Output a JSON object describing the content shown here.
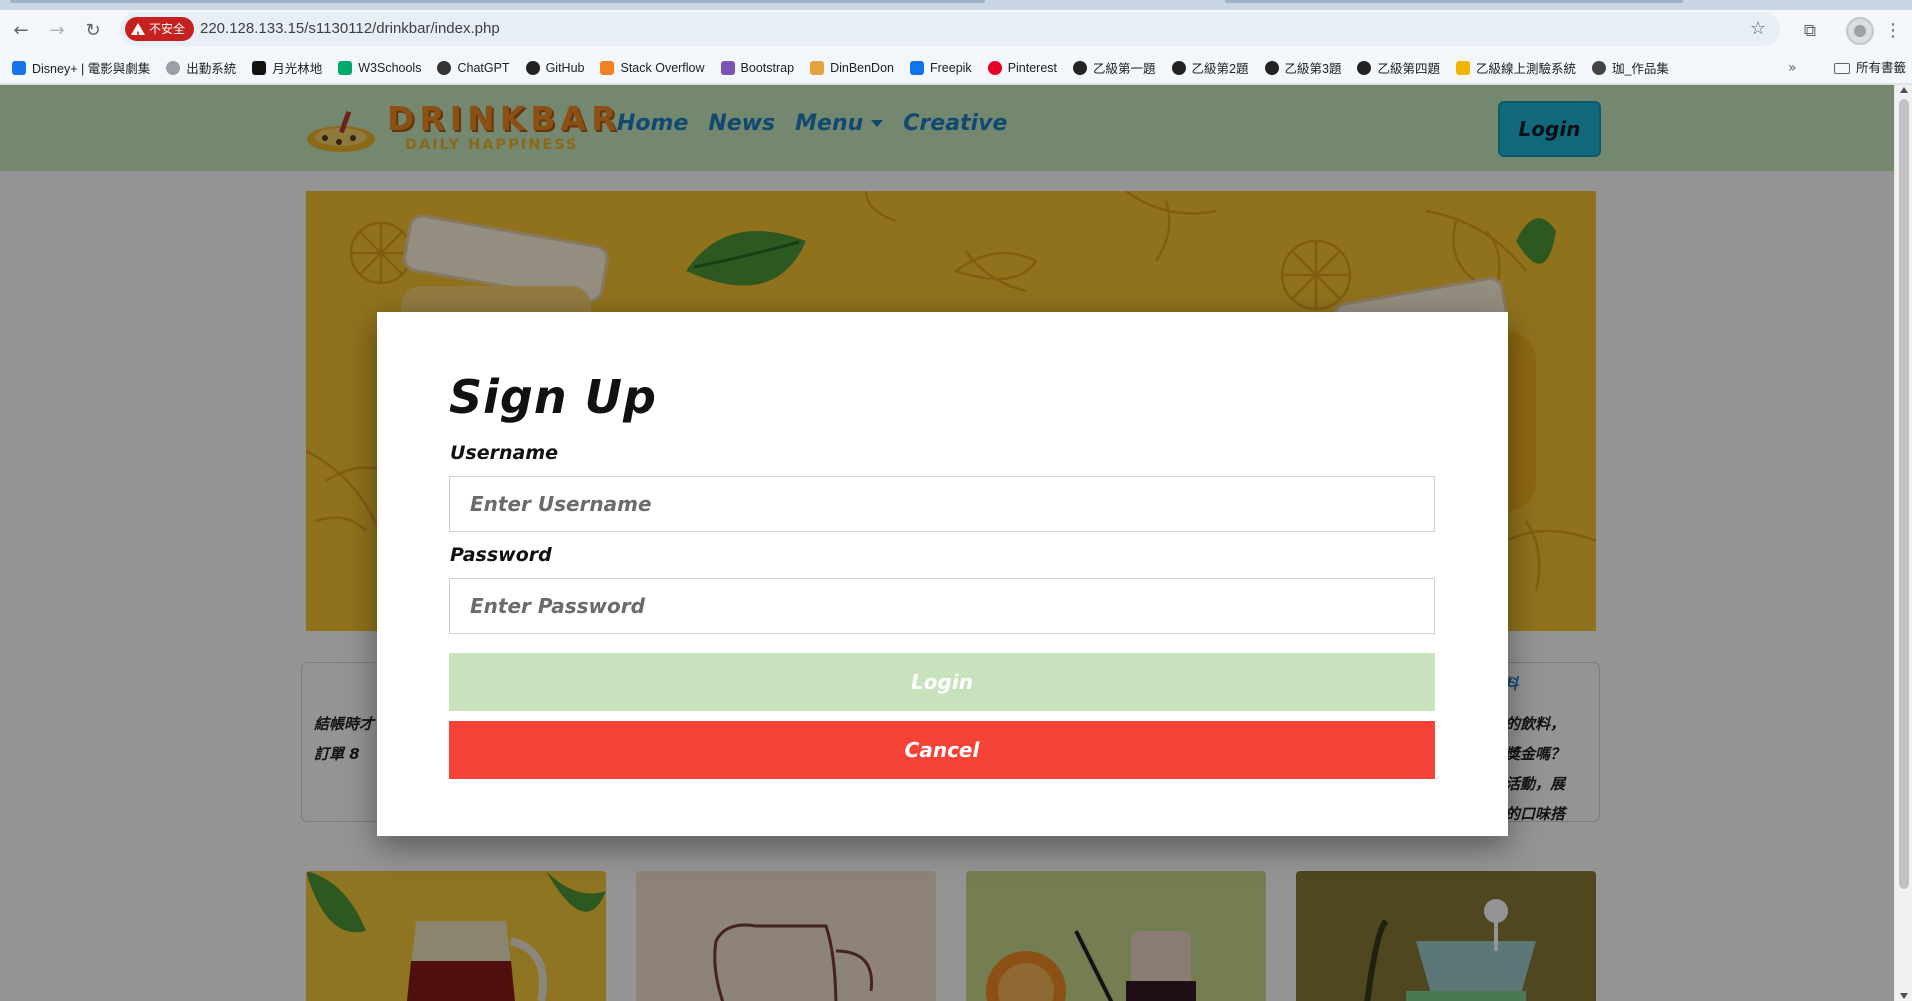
{
  "browser": {
    "security_label": "不安全",
    "url": "220.128.133.15/s1130112/drinkbar/index.php",
    "bookmarks": [
      {
        "label": "Disney+ | 電影與劇集",
        "icon": "disney-icon",
        "color": "#1a73e8"
      },
      {
        "label": "出勤系統",
        "icon": "globe-icon",
        "color": "#9aa0a6"
      },
      {
        "label": "月光林地",
        "icon": "notion-icon",
        "color": "#111111"
      },
      {
        "label": "W3Schools",
        "icon": "w3schools-icon",
        "color": "#04aa6d"
      },
      {
        "label": "ChatGPT",
        "icon": "chatgpt-icon",
        "color": "#333333"
      },
      {
        "label": "GitHub",
        "icon": "github-icon",
        "color": "#222222"
      },
      {
        "label": "Stack Overflow",
        "icon": "stackoverflow-icon",
        "color": "#f48024"
      },
      {
        "label": "Bootstrap",
        "icon": "bootstrap-icon",
        "color": "#7952b3"
      },
      {
        "label": "DinBenDon",
        "icon": "dinbendon-icon",
        "color": "#e6a23c"
      },
      {
        "label": "Freepik",
        "icon": "freepik-icon",
        "color": "#1273eb"
      },
      {
        "label": "Pinterest",
        "icon": "pinterest-icon",
        "color": "#e60023"
      },
      {
        "label": "乙級第一題",
        "icon": "github-icon",
        "color": "#222222"
      },
      {
        "label": "乙級第2題",
        "icon": "github-icon",
        "color": "#222222"
      },
      {
        "label": "乙級第3題",
        "icon": "github-icon",
        "color": "#222222"
      },
      {
        "label": "乙級第四題",
        "icon": "github-icon",
        "color": "#222222"
      },
      {
        "label": "乙級線上測驗系統",
        "icon": "exam-icon",
        "color": "#f2b400"
      },
      {
        "label": "珈_作品集",
        "icon": "globe-icon",
        "color": "#444444"
      }
    ],
    "all_bookmarks_label": "所有書籤"
  },
  "site": {
    "logo_word": "DRINKBAR",
    "logo_tagline": "DAILY HAPPINESS",
    "nav": [
      "Home",
      "News",
      "Menu",
      "Creative"
    ],
    "login_label": "Login",
    "card_left_lines": [
      "結帳時才",
      "訂單 8"
    ],
    "card_right_heading": "料",
    "card_right_lines": [
      "的飲料，",
      "獎金嗎？",
      "活動，展",
      "的口味搭"
    ]
  },
  "modal": {
    "title": "Sign Up",
    "username_label": "Username",
    "username_placeholder": "Enter Username",
    "password_label": "Password",
    "password_placeholder": "Enter Password",
    "login_button": "Login",
    "cancel_button": "Cancel"
  },
  "colors": {
    "nav_bg": "#c9e8c0",
    "nav_link": "#1e7fc4",
    "login_btn": "#1fb5d6",
    "hero_bg": "#f9c433",
    "modal_login_btn": "#c8e3bc",
    "modal_cancel_btn": "#f44336"
  }
}
